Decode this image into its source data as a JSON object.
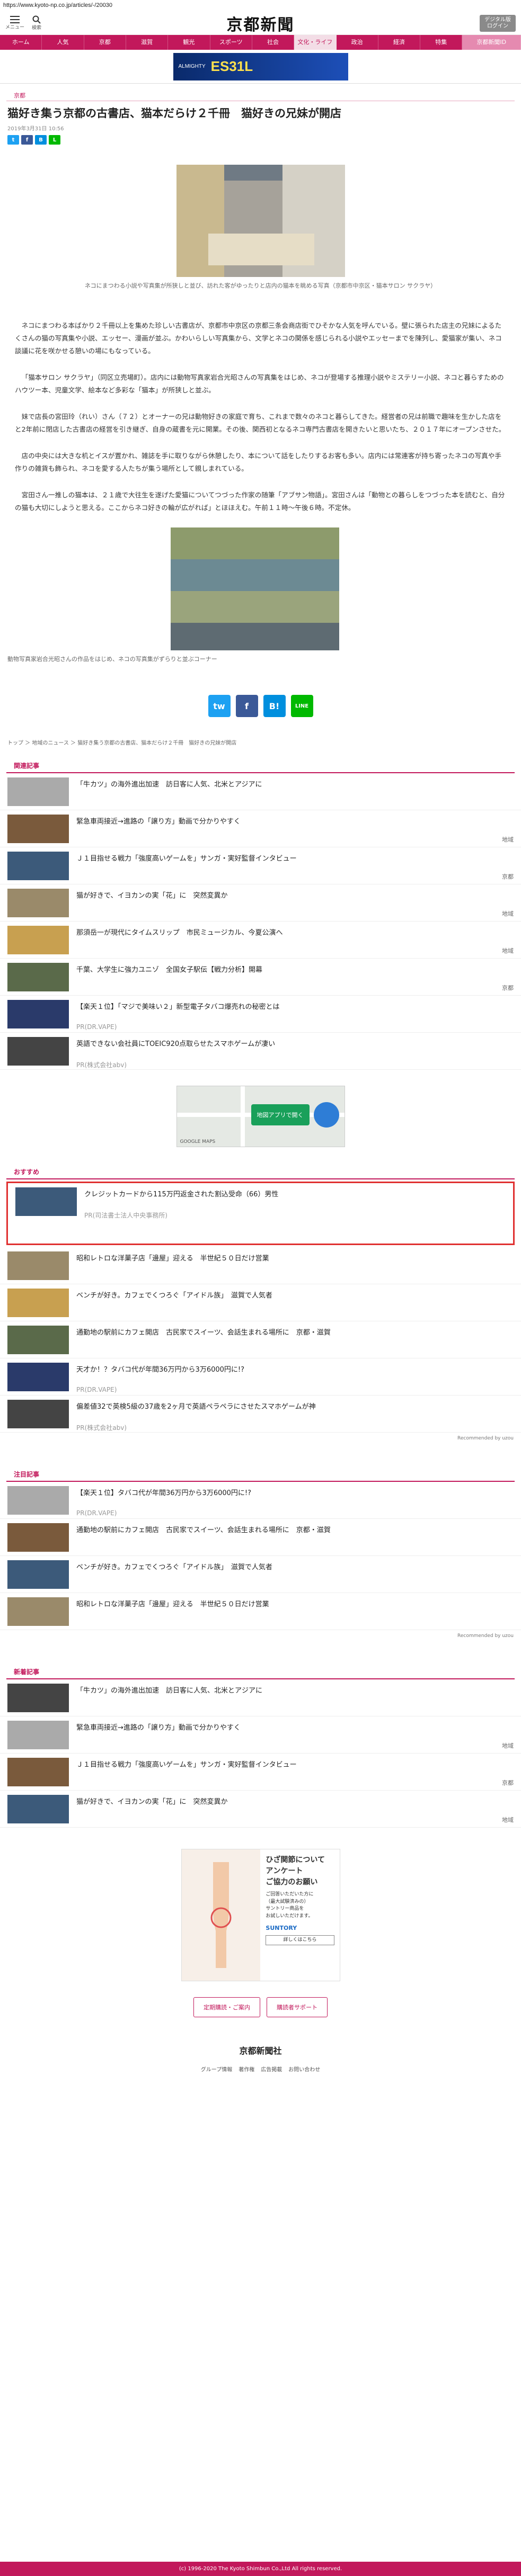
{
  "url": "https://www.kyoto-np.co.jp/articles/-/20030",
  "header": {
    "menu_label": "メニュー",
    "search_label": "検索",
    "logo": "京都新聞",
    "edition_label": "デジタル版\nログイン"
  },
  "nav": [
    "ホーム",
    "人気",
    "京都",
    "滋賀",
    "観光",
    "スポーツ",
    "社会",
    "文化・ライフ",
    "政治",
    "経済",
    "特集",
    "京都新聞ID"
  ],
  "banner": {
    "text": "ALMIGHTY",
    "big": "ES31L"
  },
  "article": {
    "section": "京都",
    "title": "猫好き集う京都の古書店、猫本だらけ２千冊　猫好きの兄妹が開店",
    "date": "2019年3月31日 10:56",
    "caption1": "ネコにまつわる小説や写真集が所狭しと並び、訪れた客がゆったりと店内の猫本を眺める写真（京都市中京区・猫本サロン サクラヤ）",
    "paragraphs": [
      "ネコにまつわる本ばかり２千冊以上を集めた珍しい古書店が、京都市中京区の京都三条会商店街でひそかな人気を呼んでいる。壁に張られた店主の兄妹によるたくさんの猫の写真集や小説、エッセー、漫画が並ぶ。かわいらしい写真集から、文学とネコの関係を感じられる小説やエッセーまでを陳列し、愛猫家が集い、ネコ談議に花を咲かせる憩いの場にもなっている。",
      "「猫本サロン サクラヤ」（同区立売場町）。店内には動物写真家岩合光昭さんの写真集をはじめ、ネコが登場する推理小説やミステリー小説、ネコと暮らすためのハウツー本、児童文学、絵本など多彩な「猫本」が所狭しと並ぶ。",
      "妹で店長の宮田玲（れい）さん（７２）とオーナーの兄は動物好きの家庭で育ち、これまで数々のネコと暮らしてきた。経営者の兄は前職で趣味を生かした店をと2年前に閉店した古書店の経営を引き継ぎ、自身の蔵書を元に開業。その後、関西初となるネコ専門古書店を開きたいと思いたち、２０１７年にオープンさせた。",
      "店の中央には大きな机とイスが置かれ、雑誌を手に取りながら休憩したり、本について話をしたりするお客も多い。店内には常連客が持ち寄ったネコの写真や手作りの雑貨も飾られ、ネコを愛する人たちが集う場所として親しまれている。",
      "宮田さん一推しの猫本は、２１歳で大往生を遂げた愛猫についてつづった作家の随筆「アブサン物語」。宮田さんは「動物との暮らしをつづった本を読むと、自分の猫も大切にしようと思える。ここからネコ好きの輪が広がれば」とほほえむ。午前１１時～午後６時。不定休。"
    ],
    "caption2": "動物写真家岩合光昭さんの作品をはじめ、ネコの写真集がずらりと並ぶコーナー",
    "share": [
      "tw",
      "f",
      "B!",
      "LINE"
    ],
    "breadcrumb": "トップ ＞ 地域のニュース ＞ 猫好き集う京都の古書店、猫本だらけ２千冊　猫好きの兄妹が開店"
  },
  "related": {
    "heading": "関連記事",
    "items": [
      {
        "text": "「牛カツ」の海外進出加速　訪日客に人気、北米とアジアに",
        "tag": ""
      },
      {
        "text": "緊急車両接近→進路の「譲り方」動画で分かりやすく",
        "tag": "地域"
      },
      {
        "text": "Ｊ１目指せる戦力「強度高いゲームを」サンガ・実好監督インタビュー",
        "tag": "京都"
      },
      {
        "text": "猫が好きで、イヨカンの実「花」に　突然変異か",
        "tag": "地域"
      },
      {
        "text": "那須岳一が現代にタイムスリップ　市民ミュージカル、今夏公演へ",
        "tag": "地域"
      },
      {
        "text": "千葉、大学生に強力ユニゾ　全国女子駅伝【戦力分析】開幕",
        "tag": "京都"
      },
      {
        "text": "【楽天１位】「マジで美味い２」新型電子タバコ爆売れの秘密とは",
        "tag": "",
        "pr": "PR(DR.VAPE)"
      },
      {
        "text": "英語できない会社員にTOEIC920点取らせたスマホゲームが凄い",
        "tag": "",
        "pr": "PR(株式会社abv)"
      }
    ]
  },
  "map": {
    "label": "GOOGLE MAPS",
    "pin": "地図アプリで開く"
  },
  "recommend": {
    "heading": "おすすめ",
    "items": [
      {
        "text": "クレジットカードから115万円返金された割込受命（66）男性",
        "tag": "",
        "pr": "PR(司法書士法人中央事務所)",
        "hl": true
      },
      {
        "text": "昭和レトロな洋菓子店「邊屋」迎える　半世紀５０日だけ営業",
        "tag": ""
      },
      {
        "text": "ベンチが好き。カフェでくつろぐ「アイドル族」　滋賀で人気者",
        "tag": ""
      },
      {
        "text": "通勤地の駅前にカフェ開店　古民家でスイーツ、会話生まれる場所に　京都・滋賀",
        "tag": ""
      },
      {
        "text": "天才か！？タバコ代が年間36万円から3万6000円に!?",
        "tag": "",
        "pr": "PR(DR.VAPE)"
      },
      {
        "text": "偏差値32で英検5級の37歳を2ヶ月で英語ペラペラにさせたスマホゲームが神",
        "tag": "",
        "pr": "PR(株式会社abv)"
      }
    ],
    "powered": "Recommended by uzou"
  },
  "popular": {
    "heading": "注目記事",
    "items": [
      {
        "text": "【楽天１位】タバコ代が年間36万円から3万6000円に!?",
        "tag": "",
        "pr": "PR(DR.VAPE)"
      },
      {
        "text": "通勤地の駅前にカフェ開店　古民家でスイーツ、会話生まれる場所に　京都・滋賀",
        "tag": ""
      },
      {
        "text": "ベンチが好き。カフェでくつろぐ「アイドル族」　滋賀で人気者",
        "tag": ""
      },
      {
        "text": "昭和レトロな洋菓子店「邊屋」迎える　半世紀５０日だけ営業",
        "tag": ""
      }
    ],
    "powered": "Recommended by uzou"
  },
  "latest": {
    "heading": "新着記事",
    "items": [
      {
        "text": "「牛カツ」の海外進出加速　訪日客に人気、北米とアジアに",
        "tag": ""
      },
      {
        "text": "緊急車両接近→進路の「譲り方」動画で分かりやすく",
        "tag": "地域"
      },
      {
        "text": "Ｊ１目指せる戦力「強度高いゲームを」サンガ・実好監督インタビュー",
        "tag": "京都"
      },
      {
        "text": "猫が好きで、イヨカンの実「花」に　突然変異か",
        "tag": "地域"
      }
    ]
  },
  "ad": {
    "title": "ひざ関節について\nアンケート\nご協力のお願い",
    "sub": "ご回答いただいた方に\n（最大試験済みの）\nサントリー商品を\nお試しいただけます。",
    "brand": "SUNTORY",
    "btn": "詳しくはこちら"
  },
  "footer": {
    "btn1": "定期購読・ご案内",
    "btn2": "購読者サポート",
    "logo": "京都新聞社",
    "links": [
      "グループ情報",
      "著作権",
      "広告掲載",
      "お問い合わせ"
    ],
    "copy": "(c) 1996-2020 The Kyoto Shimbun Co.,Ltd All rights reserved."
  }
}
